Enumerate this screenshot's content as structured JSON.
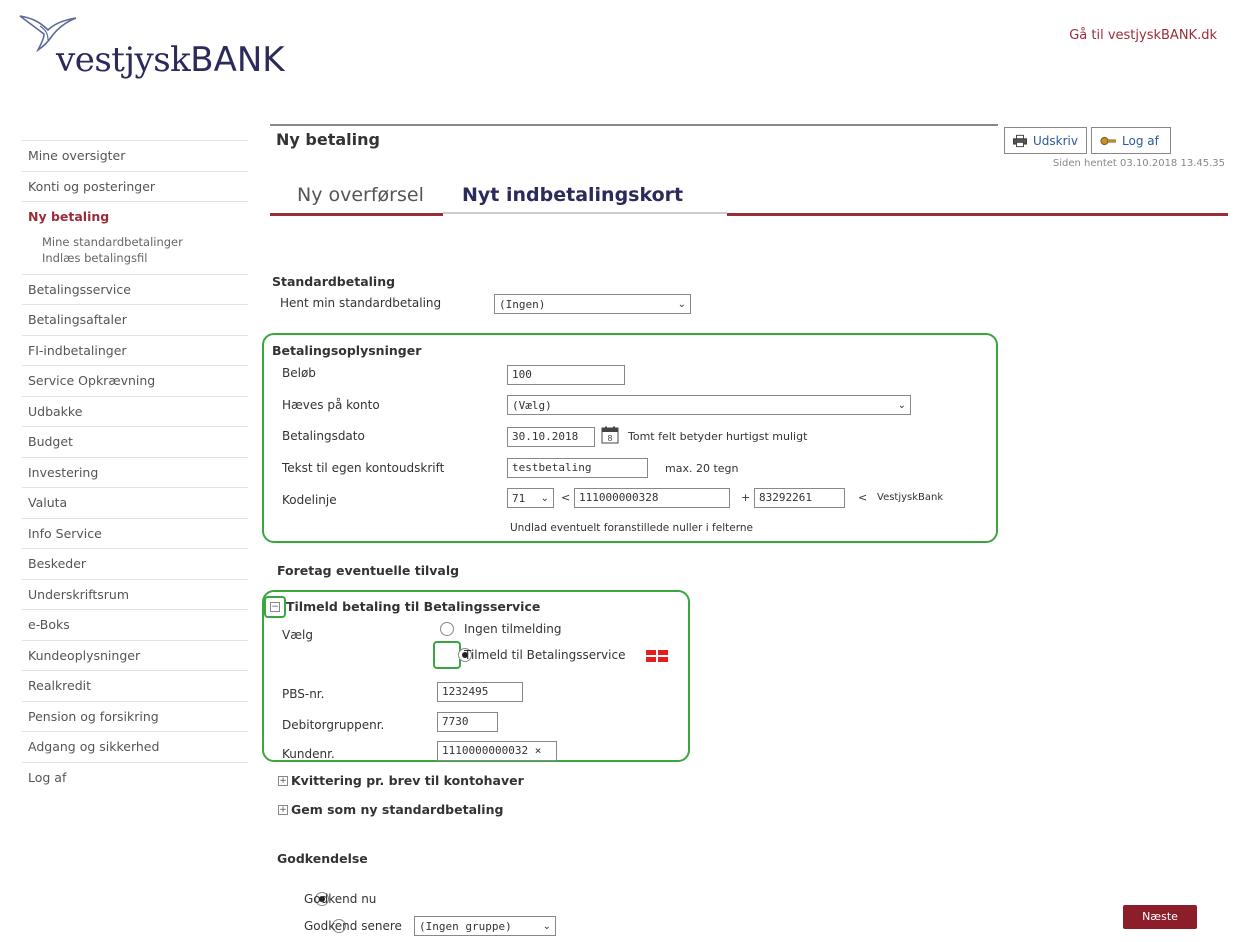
{
  "header": {
    "logo_text_a": "vestjysk",
    "logo_text_b": "BANK",
    "goto_link": "Gå til vestjyskBANK.dk"
  },
  "sidebar": {
    "items": [
      {
        "label": "Mine oversigter"
      },
      {
        "label": "Konti og posteringer"
      },
      {
        "label": "Ny betaling",
        "active": true
      },
      {
        "label": "Betalingsservice"
      },
      {
        "label": "Betalingsaftaler"
      },
      {
        "label": "FI-indbetalinger"
      },
      {
        "label": "Service Opkrævning"
      },
      {
        "label": "Udbakke"
      },
      {
        "label": "Budget"
      },
      {
        "label": "Investering"
      },
      {
        "label": "Valuta"
      },
      {
        "label": "Info Service"
      },
      {
        "label": "Beskeder"
      },
      {
        "label": "Underskriftsrum"
      },
      {
        "label": "e-Boks"
      },
      {
        "label": "Kundeoplysninger"
      },
      {
        "label": "Realkredit"
      },
      {
        "label": "Pension og forsikring"
      },
      {
        "label": "Adgang og sikkerhed"
      },
      {
        "label": "Log af"
      }
    ],
    "subitems": [
      "Mine standardbetalinger",
      "Indlæs betalingsfil"
    ]
  },
  "main": {
    "title": "Ny betaling",
    "print_label": "Udskriv",
    "logout_label": "Log af",
    "loaded_text": "Siden hentet 03.10.2018 13.45.35",
    "tabs": [
      "Ny overførsel",
      "Nyt indbetalingskort"
    ]
  },
  "standard": {
    "title": "Standardbetaling",
    "label": "Hent min standardbetaling",
    "value": "(Ingen)"
  },
  "payment": {
    "title": "Betalingsoplysninger",
    "amount_label": "Beløb",
    "amount_value": "100",
    "account_label": "Hæves på konto",
    "account_value": "(Vælg)",
    "date_label": "Betalingsdato",
    "date_value": "30.10.2018",
    "date_hint": "Tomt felt betyder hurtigst muligt",
    "text_label": "Tekst til egen kontoudskrift",
    "text_value": "testbetaling",
    "text_hint": "max. 20 tegn",
    "code_label": "Kodelinje",
    "code_type": "71",
    "code_lt": "<",
    "code_plus": "+",
    "code_ref": "111000000328",
    "code_creditor": "83292261",
    "code_lt2": "<",
    "code_bank": "VestjyskBank",
    "code_hint": "Undlad eventuelt foranstillede nuller i felterne"
  },
  "options": {
    "title": "Foretag eventuelle tilvalg",
    "bs_title": "Tilmeld betaling til Betalingsservice",
    "choose_label": "Vælg",
    "no_signup": "Ingen tilmelding",
    "signup": "Tilmeld til Betalingsservice",
    "pbs_label": "PBS-nr.",
    "pbs_value": "1232495",
    "debtor_label": "Debitorgruppenr.",
    "debtor_value": "7730",
    "customer_label": "Kundenr.",
    "customer_value": "1110000000032 ×",
    "receipt": "Kvittering pr. brev til kontohaver",
    "save_standard": "Gem som ny standardbetaling"
  },
  "approval": {
    "title": "Godkendelse",
    "now": "Godkend nu",
    "later": "Godkend senere",
    "group_value": "(Ingen gruppe)",
    "next_button": "Næste"
  },
  "colors": {
    "brand_red": "#9b2c3a",
    "brand_navy": "#2b2a5a",
    "highlight_green": "#3aa640"
  }
}
